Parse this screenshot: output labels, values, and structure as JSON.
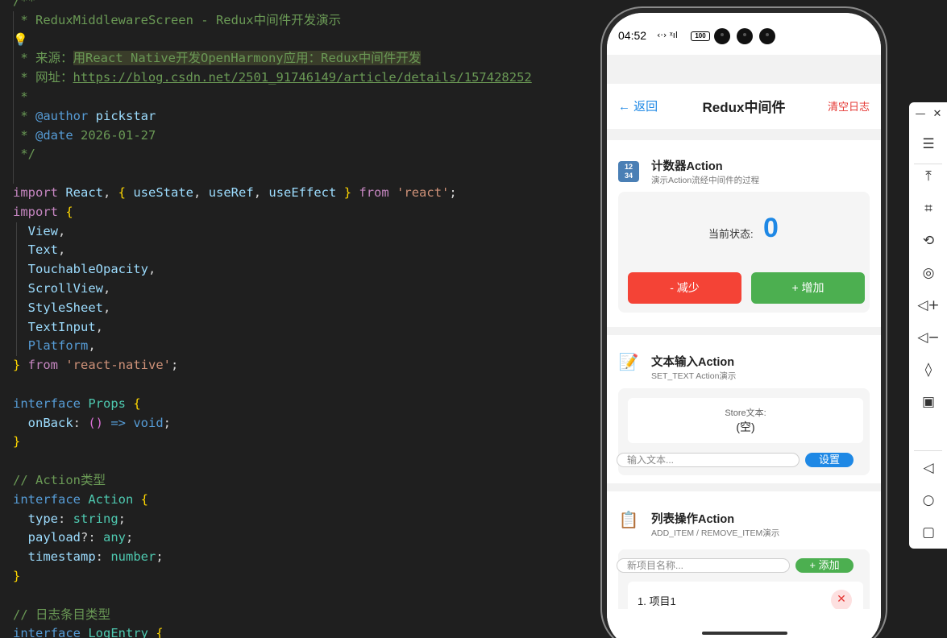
{
  "editor": {
    "lines": [
      [
        {
          "t": "/**",
          "c": "com"
        }
      ],
      [
        {
          "t": " * ReduxMiddlewareScreen - Redux中间件开发演示",
          "c": "com"
        }
      ],
      [
        {
          "t": "💡",
          "c": "bulb"
        }
      ],
      [
        {
          "t": " * 来源：",
          "c": "com"
        },
        {
          "t": "用React Native开发OpenHarmony应用：Redux中间件开发",
          "c": "com hl"
        }
      ],
      [
        {
          "t": " * 网址：",
          "c": "com"
        },
        {
          "t": "https://blog.csdn.net/2501_91746149/article/details/157428252",
          "c": "com link"
        }
      ],
      [
        {
          "t": " *",
          "c": "com"
        }
      ],
      [
        {
          "t": " * ",
          "c": "com"
        },
        {
          "t": "@author",
          "c": "kw"
        },
        {
          "t": " pickstar",
          "c": "id"
        }
      ],
      [
        {
          "t": " * ",
          "c": "com"
        },
        {
          "t": "@date",
          "c": "kw"
        },
        {
          "t": " 2026-01-27",
          "c": "com"
        }
      ],
      [
        {
          "t": " */",
          "c": "com"
        }
      ],
      [
        {
          "t": "",
          "c": "plain"
        }
      ],
      [
        {
          "t": "import",
          "c": "kw2"
        },
        {
          "t": " React",
          "c": "id"
        },
        {
          "t": ", ",
          "c": "plain"
        },
        {
          "t": "{",
          "c": "brace"
        },
        {
          "t": " useState",
          "c": "id"
        },
        {
          "t": ", ",
          "c": "plain"
        },
        {
          "t": "useRef",
          "c": "id"
        },
        {
          "t": ", ",
          "c": "plain"
        },
        {
          "t": "useEffect",
          "c": "id"
        },
        {
          "t": " }",
          "c": "brace"
        },
        {
          "t": " from",
          "c": "kw2"
        },
        {
          "t": " 'react'",
          "c": "str"
        },
        {
          "t": ";",
          "c": "plain"
        }
      ],
      [
        {
          "t": "import",
          "c": "kw2"
        },
        {
          "t": " {",
          "c": "brace"
        }
      ],
      [
        {
          "t": "  View",
          "c": "id"
        },
        {
          "t": ",",
          "c": "plain"
        }
      ],
      [
        {
          "t": "  Text",
          "c": "id"
        },
        {
          "t": ",",
          "c": "plain"
        }
      ],
      [
        {
          "t": "  TouchableOpacity",
          "c": "id"
        },
        {
          "t": ",",
          "c": "plain"
        }
      ],
      [
        {
          "t": "  ScrollView",
          "c": "id"
        },
        {
          "t": ",",
          "c": "plain"
        }
      ],
      [
        {
          "t": "  StyleSheet",
          "c": "id"
        },
        {
          "t": ",",
          "c": "plain"
        }
      ],
      [
        {
          "t": "  TextInput",
          "c": "id"
        },
        {
          "t": ",",
          "c": "plain"
        }
      ],
      [
        {
          "t": "  Platform",
          "c": "kw"
        },
        {
          "t": ",",
          "c": "plain"
        }
      ],
      [
        {
          "t": "}",
          "c": "brace"
        },
        {
          "t": " from",
          "c": "kw2"
        },
        {
          "t": " 'react-native'",
          "c": "str"
        },
        {
          "t": ";",
          "c": "plain"
        }
      ],
      [
        {
          "t": "",
          "c": "plain"
        }
      ],
      [
        {
          "t": "interface",
          "c": "kw"
        },
        {
          "t": " Props",
          "c": "type"
        },
        {
          "t": " {",
          "c": "brace"
        }
      ],
      [
        {
          "t": "  onBack",
          "c": "id"
        },
        {
          "t": ": ",
          "c": "plain"
        },
        {
          "t": "()",
          "c": "brace2"
        },
        {
          "t": " =>",
          "c": "kw"
        },
        {
          "t": " void",
          "c": "kw"
        },
        {
          "t": ";",
          "c": "plain"
        }
      ],
      [
        {
          "t": "}",
          "c": "brace"
        }
      ],
      [
        {
          "t": "",
          "c": "plain"
        }
      ],
      [
        {
          "t": "// Action类型",
          "c": "com"
        }
      ],
      [
        {
          "t": "interface",
          "c": "kw"
        },
        {
          "t": " Action",
          "c": "type"
        },
        {
          "t": " {",
          "c": "brace"
        }
      ],
      [
        {
          "t": "  type",
          "c": "id"
        },
        {
          "t": ": ",
          "c": "plain"
        },
        {
          "t": "string",
          "c": "type"
        },
        {
          "t": ";",
          "c": "plain"
        }
      ],
      [
        {
          "t": "  payload",
          "c": "id"
        },
        {
          "t": "?: ",
          "c": "plain"
        },
        {
          "t": "any",
          "c": "type"
        },
        {
          "t": ";",
          "c": "plain"
        }
      ],
      [
        {
          "t": "  timestamp",
          "c": "id"
        },
        {
          "t": ": ",
          "c": "plain"
        },
        {
          "t": "number",
          "c": "type"
        },
        {
          "t": ";",
          "c": "plain"
        }
      ],
      [
        {
          "t": "}",
          "c": "brace"
        }
      ],
      [
        {
          "t": "",
          "c": "plain"
        }
      ],
      [
        {
          "t": "// 日志条目类型",
          "c": "com"
        }
      ],
      [
        {
          "t": "interface",
          "c": "kw"
        },
        {
          "t": " LogEntry",
          "c": "type"
        },
        {
          "t": " {",
          "c": "brace"
        }
      ]
    ]
  },
  "phone": {
    "status": {
      "time": "04:52",
      "icons": "‹·› ᵡıl",
      "battery": "100"
    },
    "nav": {
      "back": "← 返回",
      "title": "Redux中间件",
      "clear": "清空日志"
    },
    "counter": {
      "icon": "1234",
      "title": "计数器Action",
      "subtitle": "演示Action流经中间件的过程",
      "state_label": "当前状态:",
      "state_value": "0",
      "dec_label": "- 减少",
      "inc_label": "+ 增加"
    },
    "text_card": {
      "icon": "📝",
      "title": "文本输入Action",
      "subtitle": "SET_TEXT Action演示",
      "store_label": "Store文本:",
      "store_value": "(空)",
      "input_placeholder": "输入文本...",
      "set_label": "设置"
    },
    "list_card": {
      "icon": "📋",
      "title": "列表操作Action",
      "subtitle": "ADD_ITEM / REMOVE_ITEM演示",
      "input_placeholder": "新项目名称...",
      "add_label": "+ 添加",
      "items": [
        "1. 项目1"
      ]
    }
  },
  "toolbar": {
    "buttons": [
      "minimize-icon",
      "close-icon",
      "menu-icon",
      "pin-top-icon",
      "crop-icon",
      "rotate-icon",
      "screenshot-icon",
      "volume-up-icon",
      "volume-down-icon",
      "shake-icon",
      "devices-icon",
      "back-icon",
      "home-icon",
      "recents-icon"
    ]
  },
  "colors": {
    "accent": "#1e88e5",
    "danger": "#f44336",
    "success": "#4caf50"
  }
}
